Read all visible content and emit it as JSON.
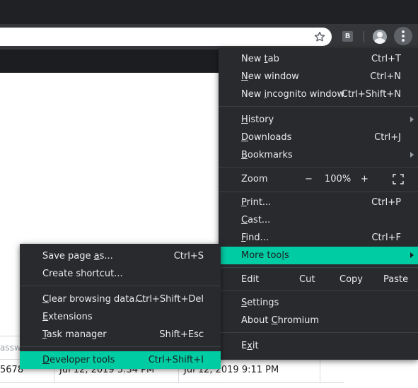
{
  "toolbar": {
    "star_icon": "star-icon",
    "extension_badge": "B",
    "avatar_icon": "avatar-icon",
    "menu_icon": "kebab-menu-icon"
  },
  "table": {
    "header_partial": "assw",
    "row": [
      "5678",
      "Jul 12, 2019 5:34 PM",
      "Jul 12, 2019 9:11 PM"
    ]
  },
  "main_menu": {
    "new_tab": {
      "pre": "New ",
      "ul": "t",
      "post": "ab",
      "sc": "Ctrl+T"
    },
    "new_window": {
      "pre": "",
      "ul": "N",
      "post": "ew window",
      "sc": "Ctrl+N"
    },
    "new_incognito": {
      "pre": "New ",
      "ul": "i",
      "post": "ncognito window",
      "sc": "Ctrl+Shift+N"
    },
    "history": {
      "pre": "",
      "ul": "H",
      "post": "istory"
    },
    "downloads": {
      "pre": "",
      "ul": "D",
      "post": "ownloads",
      "sc": "Ctrl+J"
    },
    "bookmarks": {
      "pre": "",
      "ul": "B",
      "post": "ookmarks"
    },
    "zoom": {
      "label": "Zoom",
      "minus": "−",
      "value": "100%",
      "plus": "+"
    },
    "print": {
      "pre": "",
      "ul": "P",
      "post": "rint...",
      "sc": "Ctrl+P"
    },
    "cast": {
      "pre": "",
      "ul": "C",
      "post": "ast..."
    },
    "find": {
      "pre": "",
      "ul": "F",
      "post": "ind...",
      "sc": "Ctrl+F"
    },
    "more_tools": {
      "pre": "More too",
      "ul": "l",
      "post": "s"
    },
    "edit": {
      "label": "Edit",
      "cut": "Cut",
      "copy": "Copy",
      "paste": "Paste"
    },
    "settings": {
      "pre": "",
      "ul": "S",
      "post": "ettings"
    },
    "about": {
      "pre": "About ",
      "ul": "C",
      "post": "hromium"
    },
    "exit": {
      "pre": "E",
      "ul": "x",
      "post": "it"
    }
  },
  "sub_menu": {
    "save_page": {
      "pre": "Save page ",
      "ul": "a",
      "post": "s...",
      "sc": "Ctrl+S"
    },
    "create_shortcut": {
      "label": "Create shortcut..."
    },
    "clear_browsing": {
      "pre": "",
      "ul": "C",
      "post": "lear browsing data...",
      "sc": "Ctrl+Shift+Del"
    },
    "extensions": {
      "pre": "",
      "ul": "E",
      "post": "xtensions"
    },
    "task_manager": {
      "pre": "",
      "ul": "T",
      "post": "ask manager",
      "sc": "Shift+Esc"
    },
    "developer_tools": {
      "pre": "",
      "ul": "D",
      "post": "eveloper tools",
      "sc": "Ctrl+Shift+I"
    }
  },
  "colors": {
    "menu_bg": "#292a2d",
    "highlight": "#00cca3",
    "toolbar_bg": "#35363a",
    "titlebar_bg": "#202124"
  }
}
